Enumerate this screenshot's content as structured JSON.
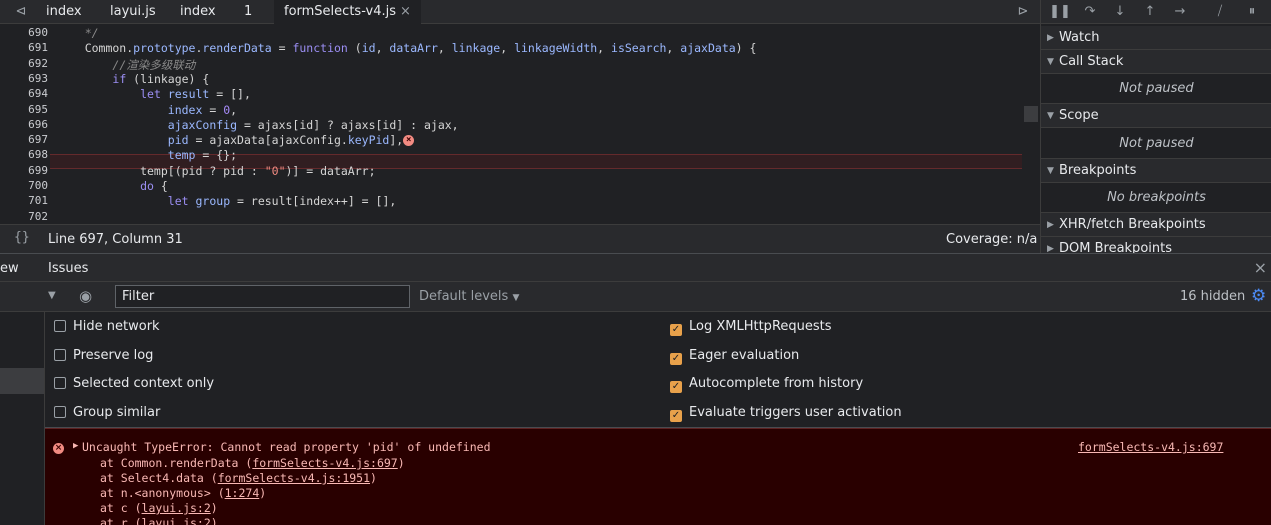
{
  "editor_tabs": [
    {
      "label": "index"
    },
    {
      "label": "layui.js"
    },
    {
      "label": "index"
    },
    {
      "label": "1"
    },
    {
      "label": "formSelects-v4.js",
      "active": true
    }
  ],
  "editor_tab_close": "×",
  "code_lines": [
    {
      "num": "690",
      "html": "    <span class=\"cmt\">*/</span>"
    },
    {
      "num": "691",
      "html": "    Common.<span class=\"prop\">prototype</span>.<span class=\"prop\">renderData</span> = <span class=\"kw\">function</span> (<span class=\"prop\">id</span>, <span class=\"prop\">dataArr</span>, <span class=\"prop\">linkage</span>, <span class=\"prop\">linkageWidth</span>, <span class=\"prop\">isSearch</span>, <span class=\"prop\">ajaxData</span>) {"
    },
    {
      "num": "692",
      "html": "        <span class=\"cmt\">//渲染多级联动</span>"
    },
    {
      "num": "693",
      "html": "        <span class=\"kw\">if</span> (linkage) {"
    },
    {
      "num": "694",
      "html": "            <span class=\"kw\">let</span> <span class=\"prop\">result</span> = [],"
    },
    {
      "num": "695",
      "html": "                <span class=\"prop\">index</span> = <span class=\"num\">0</span>,"
    },
    {
      "num": "696",
      "html": "                <span class=\"prop\">ajaxConfig</span> = ajaxs[id] ? ajaxs[id] : ajax,"
    },
    {
      "num": "697",
      "html": "                <span class=\"prop\">pid</span> = ajaxData[ajaxConfig.<span class=\"prop\">keyPid</span>],<span class=\"errdot\">×</span>"
    },
    {
      "num": "698",
      "html": "                <span class=\"prop\">temp</span> = {};"
    },
    {
      "num": "699",
      "html": "            temp[(pid ? pid : <span class=\"str\">\"0\"</span>)] = dataArr;"
    },
    {
      "num": "700",
      "html": "            <span class=\"kw\">do</span> {"
    },
    {
      "num": "701",
      "html": "                <span class=\"kw\">let</span> <span class=\"prop\">group</span> = result[index++] = [],"
    },
    {
      "num": "702",
      "html": ""
    }
  ],
  "status_bar": {
    "format_icon": "{}",
    "position": "Line 697, Column 31",
    "coverage": "Coverage: n/a"
  },
  "sidebar": {
    "sections": [
      {
        "title": "Watch",
        "expanded": false
      },
      {
        "title": "Call Stack",
        "expanded": true,
        "body": "Not paused"
      },
      {
        "title": "Scope",
        "expanded": true,
        "body": "Not paused"
      },
      {
        "title": "Breakpoints",
        "expanded": true,
        "body": "No breakpoints"
      },
      {
        "title": "XHR/fetch Breakpoints",
        "expanded": false
      },
      {
        "title": "DOM Breakpoints",
        "expanded": false
      }
    ]
  },
  "drawer": {
    "tabs": [
      "ew",
      "Issues"
    ],
    "close": "×"
  },
  "console_toolbar": {
    "filter_placeholder": "Filter",
    "levels": "Default levels",
    "hidden_count": "16 hidden"
  },
  "settings": {
    "left": [
      {
        "label": "Hide network",
        "checked": false
      },
      {
        "label": "Preserve log",
        "checked": false
      },
      {
        "label": "Selected context only",
        "checked": false
      },
      {
        "label": "Group similar",
        "checked": false
      }
    ],
    "right": [
      {
        "label": "Log XMLHttpRequests",
        "checked": true
      },
      {
        "label": "Eager evaluation",
        "checked": true
      },
      {
        "label": "Autocomplete from history",
        "checked": true
      },
      {
        "label": "Evaluate triggers user activation",
        "checked": true
      }
    ]
  },
  "console": {
    "error_title": "Uncaught TypeError: Cannot read property 'pid' of undefined",
    "error_source": "formSelects-v4.js:697",
    "stack": [
      {
        "prefix": "at Common.renderData (",
        "link": "formSelects-v4.js:697",
        "suffix": ")"
      },
      {
        "prefix": "at Select4.data (",
        "link": "formSelects-v4.js:1951",
        "suffix": ")"
      },
      {
        "prefix": "at n.<anonymous> (",
        "link": "1:274",
        "suffix": ")"
      },
      {
        "prefix": "at c (",
        "link": "layui.js:2",
        "suffix": ")"
      },
      {
        "prefix": "at r (",
        "link": "layui.js:2",
        "suffix": ")"
      }
    ]
  },
  "colors": {
    "accent": "#e8a14b",
    "error_bg": "#290000",
    "error_text": "#f9b8b4"
  }
}
